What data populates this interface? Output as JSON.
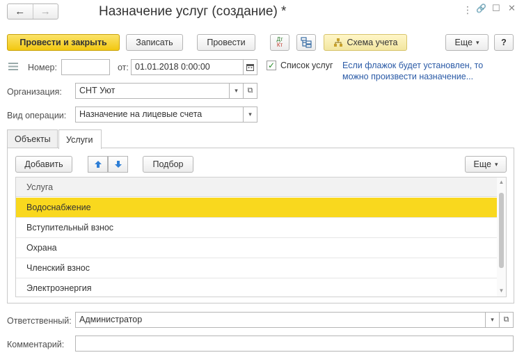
{
  "window": {
    "title": "Назначение услуг (создание) *",
    "menu_icon": "⋮",
    "link_icon": "🔗",
    "maximize_icon": "☐",
    "close_icon": "✕"
  },
  "nav": {
    "back_icon": "←",
    "forward_icon": "→"
  },
  "toolbar": {
    "post_close": "Провести и закрыть",
    "save": "Записать",
    "post": "Провести",
    "dt_kt_top": "Дт",
    "dt_kt_bottom": "Кт",
    "schema": "Схема учета",
    "more": "Еще",
    "help": "?"
  },
  "form": {
    "number_label": "Номер:",
    "number_value": "",
    "date_label": "от:",
    "date_value": "01.01.2018  0:00:00",
    "services_list_label": "Список услуг",
    "services_list_checked": "✓",
    "hint": "Если флажок будет установлен, то можно произвести назначение...",
    "org_label": "Организация:",
    "org_value": "СНТ Уют",
    "op_label": "Вид операции:",
    "op_value": "Назначение на лицевые счета",
    "responsible_label": "Ответственный:",
    "responsible_value": "Администратор",
    "comment_label": "Комментарий:",
    "comment_value": ""
  },
  "tabs": [
    {
      "label": "Объекты",
      "active": false
    },
    {
      "label": "Услуги",
      "active": true
    }
  ],
  "table_toolbar": {
    "add": "Добавить",
    "pick": "Подбор",
    "more": "Еще"
  },
  "table": {
    "column": "Услуга",
    "rows": [
      {
        "name": "Водоснабжение",
        "selected": true
      },
      {
        "name": "Вступительный взнос",
        "selected": false
      },
      {
        "name": "Охрана",
        "selected": false
      },
      {
        "name": "Членский взнос",
        "selected": false
      },
      {
        "name": "Электроэнергия",
        "selected": false
      }
    ]
  }
}
